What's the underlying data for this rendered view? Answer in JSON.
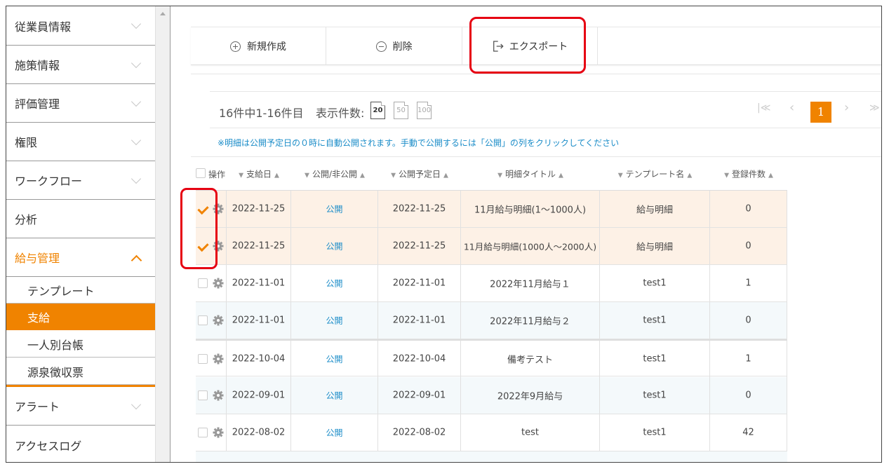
{
  "sidebar": {
    "items": [
      {
        "label": "従業員情報"
      },
      {
        "label": "施策情報"
      },
      {
        "label": "評価管理"
      },
      {
        "label": "権限"
      },
      {
        "label": "ワークフロー"
      },
      {
        "label": "分析"
      },
      {
        "label": "給与管理"
      }
    ],
    "subitems": [
      {
        "label": "テンプレート"
      },
      {
        "label": "支給"
      },
      {
        "label": "一人別台帳"
      },
      {
        "label": "源泉徴収票"
      }
    ],
    "items_after": [
      {
        "label": "アラート"
      },
      {
        "label": "アクセスログ"
      }
    ],
    "active_color": "#f08300"
  },
  "toolbar": {
    "new_label": "新規作成",
    "delete_label": "削除",
    "export_label": "エクスポート"
  },
  "listing": {
    "count_text": "16件中1-16件目",
    "show_label": "表示件数:",
    "sizes": [
      "20",
      "50",
      "100"
    ],
    "current_page": "1",
    "first_icon": "|≪",
    "prev_icon": "‹",
    "next_icon": "›",
    "last_icon": "≫"
  },
  "notice": "※明細は公開予定日の０時に自動公開されます。手動で公開するには「公開」の列をクリックしてください",
  "table": {
    "headers": [
      "操作",
      "支給日",
      "公開/非公開",
      "公開予定日",
      "明細タイトル",
      "テンプレート名",
      "登録件数"
    ],
    "rows": [
      {
        "date": "2022-11-25",
        "pub": "公開",
        "sched": "2022-11-25",
        "title": "11月給与明細(1～1000人)",
        "tpl": "給与明細",
        "count": "0"
      },
      {
        "date": "2022-11-25",
        "pub": "公開",
        "sched": "2022-11-25",
        "title": "11月給与明細(1000人～2000人)",
        "tpl": "給与明細",
        "count": "0"
      },
      {
        "date": "2022-11-01",
        "pub": "公開",
        "sched": "2022-11-01",
        "title": "2022年11月給与１",
        "tpl": "test1",
        "count": "1"
      },
      {
        "date": "2022-11-01",
        "pub": "公開",
        "sched": "2022-11-01",
        "title": "2022年11月給与２",
        "tpl": "test1",
        "count": "0"
      },
      {
        "date": "2022-10-04",
        "pub": "公開",
        "sched": "2022-10-04",
        "title": "備考テスト",
        "tpl": "test1",
        "count": "1"
      },
      {
        "date": "2022-09-01",
        "pub": "公開",
        "sched": "2022-09-01",
        "title": "2022年9月給与",
        "tpl": "test1",
        "count": "0"
      },
      {
        "date": "2022-08-02",
        "pub": "公開",
        "sched": "2022-08-02",
        "title": "test",
        "tpl": "test1",
        "count": "42"
      }
    ]
  },
  "colors": {
    "accent": "#f08300",
    "link": "#1a8cc8",
    "annotation": "#e60012"
  }
}
